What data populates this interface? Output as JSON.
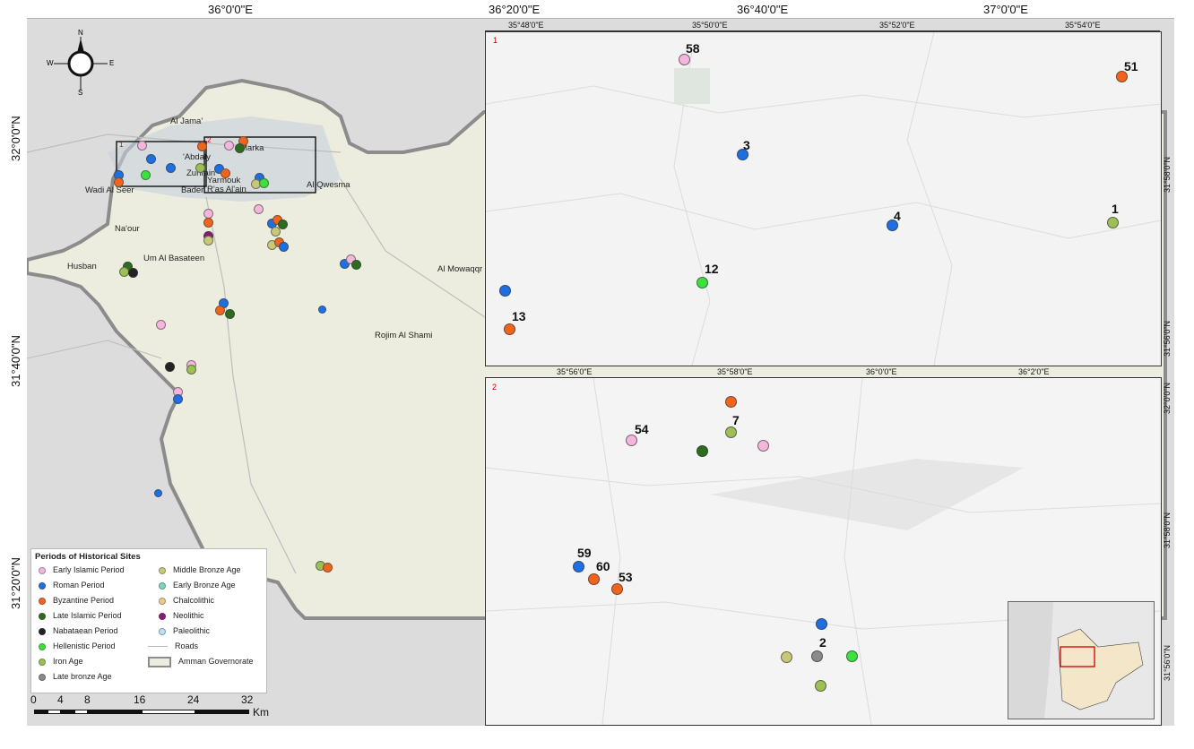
{
  "top_coords": [
    "36°0'0\"E",
    "36°20'0\"E",
    "36°40'0\"E",
    "37°0'0\"E"
  ],
  "left_coords": [
    "32°0'0\"N",
    "31°40'0\"N",
    "31°20'0\"N"
  ],
  "north_arrow": {
    "n": "N",
    "s": "S",
    "w": "W",
    "e": "E"
  },
  "towns": {
    "al_jama": "Al Jama'",
    "abdaly": "'Abdaly",
    "marka": "Marka",
    "zuhrain": "Zuhrain",
    "yarmouk": "Yarmouk",
    "bader": "Bader",
    "ras_al_ain": "R'as Al'ain",
    "al_qwesma": "Al Qwesma",
    "wadi_al_seer": "Wadi Al Seer",
    "naour": "Na'our",
    "um_al_basateen": "Um Al Basateen",
    "husban": "Husban",
    "al_mowaqqar": "Al Mowaqqr",
    "rojim_al_shami": "Rojim Al Shami"
  },
  "frame_labels": {
    "frame1": "1",
    "frame2": "2"
  },
  "inset1": {
    "label": "1",
    "top_coords": [
      "35°48'0\"E",
      "35°50'0\"E",
      "35°52'0\"E",
      "35°54'0\"E"
    ],
    "right_coords": [
      "31°58'0\"N",
      "31°56'0\"N"
    ],
    "sites": [
      "58",
      "51",
      "3",
      "4",
      "1",
      "12",
      "13"
    ]
  },
  "inset2": {
    "label": "2",
    "top_coords": [
      "35°56'0\"E",
      "35°58'0\"E",
      "36°0'0\"E",
      "36°2'0\"E"
    ],
    "right_coords": [
      "32°0'0\"N",
      "31°58'0\"N",
      "31°56'0\"N"
    ],
    "sites": [
      "54",
      "7",
      "59",
      "60",
      "53",
      "2"
    ]
  },
  "legend": {
    "title": "Periods of Historical Sites",
    "items_left": [
      {
        "label": "Early Islamic Period",
        "color": "#f4b6dc"
      },
      {
        "label": "Roman Period",
        "color": "#1f6fe0"
      },
      {
        "label": "Byzantine Period",
        "color": "#f0651e"
      },
      {
        "label": "Late Islamic Period",
        "color": "#2d6b1e"
      },
      {
        "label": "Nabataean Period",
        "color": "#222222"
      },
      {
        "label": "Hellenistic Period",
        "color": "#3de03d"
      },
      {
        "label": "Iron Age",
        "color": "#9cbf56"
      },
      {
        "label": "Late bronze Age",
        "color": "#8a8a8a"
      }
    ],
    "items_right": [
      {
        "label": "Middle Bronze Age",
        "color": "#c8c87a"
      },
      {
        "label": "Early Bronze Age",
        "color": "#7fd6c0"
      },
      {
        "label": "Chalcolithic",
        "color": "#f0c889"
      },
      {
        "label": "Neolithic",
        "color": "#8a1a7a"
      },
      {
        "label": "Paleolithic",
        "color": "#b8e0f6"
      }
    ],
    "roads": "Roads",
    "governorate": "Amman Governorate"
  },
  "scale": {
    "ticks": [
      "0",
      "4",
      "8",
      "16",
      "24",
      "32"
    ],
    "unit": "Km"
  }
}
